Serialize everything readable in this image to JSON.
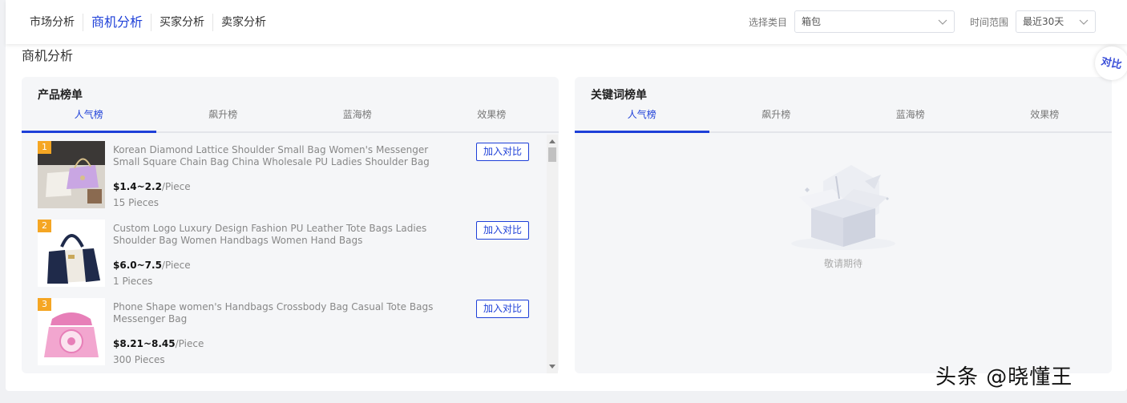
{
  "nav": {
    "items": [
      {
        "label": "市场分析",
        "active": false
      },
      {
        "label": "商机分析",
        "active": true
      },
      {
        "label": "买家分析",
        "active": false
      },
      {
        "label": "卖家分析",
        "active": false
      }
    ]
  },
  "filters": {
    "category_label": "选择类目",
    "category_value": "箱包",
    "range_label": "时间范围",
    "range_value": "最近30天"
  },
  "page_title": "商机分析",
  "compare_float_label": "对比",
  "product_panel": {
    "title": "产品榜单",
    "tabs": [
      "人气榜",
      "飙升榜",
      "蓝海榜",
      "效果榜"
    ],
    "active_tab": 0,
    "add_label": "加入对比",
    "items": [
      {
        "rank": "1",
        "name": "Korean Diamond Lattice Shoulder Small Bag Women's Messenger Small Square Chain Bag China Wholesale PU Ladies Shoulder Bag",
        "price": "$1.4~2.2",
        "unit": "/Piece",
        "qty": "15 Pieces"
      },
      {
        "rank": "2",
        "name": "Custom Logo Luxury Design Fashion PU Leather Tote Bags Ladies Shoulder Bag Women Handbags Women Hand Bags",
        "price": "$6.0~7.5",
        "unit": "/Piece",
        "qty": "1 Pieces"
      },
      {
        "rank": "3",
        "name": "Phone Shape women's Handbags Crossbody Bag Casual Tote Bags Messenger Bag",
        "price": "$8.21~8.45",
        "unit": "/Piece",
        "qty": "300 Pieces"
      }
    ]
  },
  "keyword_panel": {
    "title": "关键词榜单",
    "tabs": [
      "人气榜",
      "飙升榜",
      "蓝海榜",
      "效果榜"
    ],
    "active_tab": 0,
    "empty_text": "敬请期待"
  },
  "watermark": "头条 @晓懂王",
  "colors": {
    "accent": "#1d3fd8",
    "rank_badge": "#f5a623",
    "panel_bg": "#f5f6f8"
  }
}
